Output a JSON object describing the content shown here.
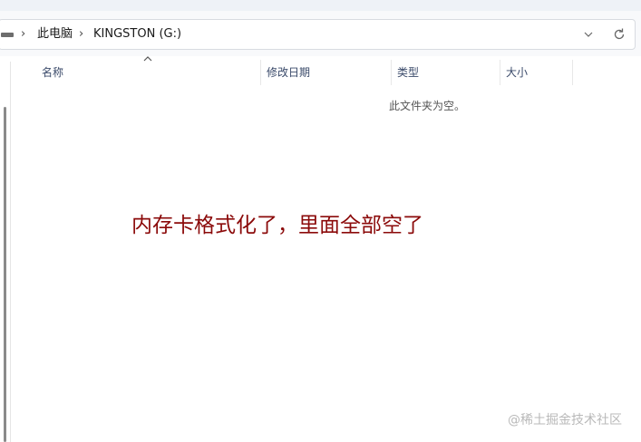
{
  "address": {
    "crumbs": [
      "此电脑",
      "KINGSTON (G:)"
    ]
  },
  "columns": [
    "名称",
    "修改日期",
    "类型",
    "大小"
  ],
  "empty_message": "此文件夹为空。",
  "annotation": "内存卡格式化了，里面全部空了",
  "watermark": "@稀土掘金技术社区",
  "icons": {
    "drive": "drive-icon",
    "separator": "chevron-right-icon",
    "dropdown": "chevron-down-icon",
    "refresh": "refresh-icon",
    "sort": "sort-up-icon"
  },
  "colors": {
    "annotation": "#8b0a0a",
    "header_text": "#3a4a6a",
    "watermark": "#b9b9b9"
  }
}
